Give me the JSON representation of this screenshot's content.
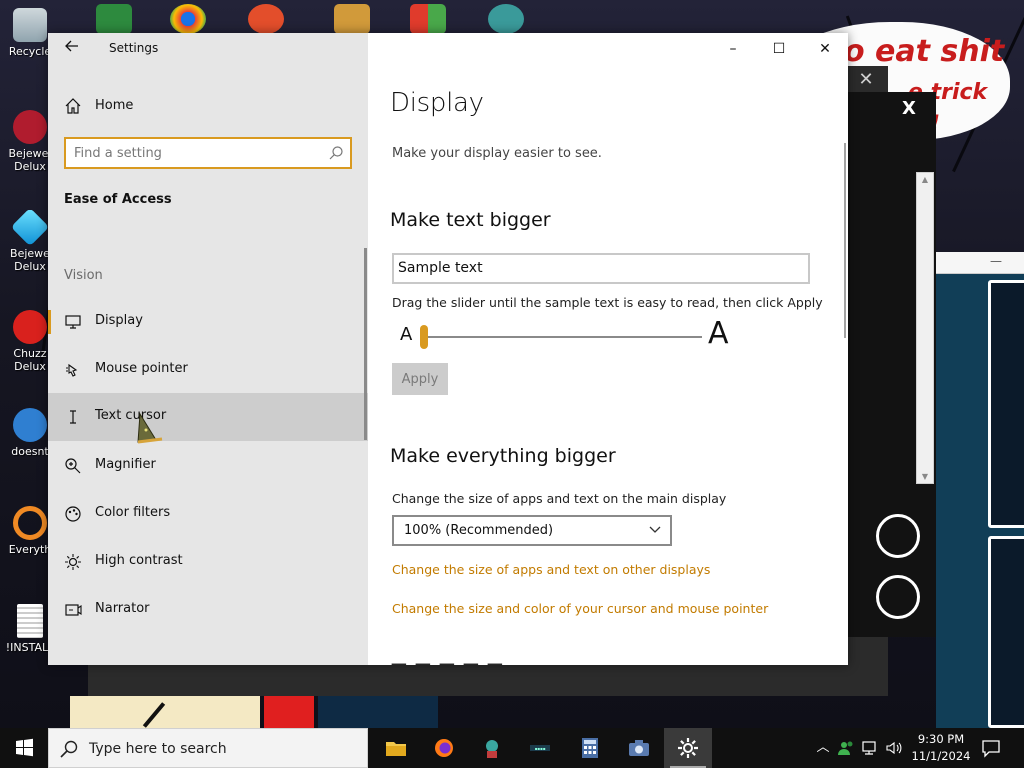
{
  "desktop": {
    "icons": [
      {
        "label": "Recycle",
        "name": "recycle-bin"
      },
      {
        "label": "Bejewel Delux",
        "name": "bejeweled-2"
      },
      {
        "label": "Bejewe Delux",
        "name": "bejeweled-3"
      },
      {
        "label": "Chuzz Delux",
        "name": "chuzzle"
      },
      {
        "label": "doesnt",
        "name": "doesnt"
      },
      {
        "label": "Everyth",
        "name": "everything"
      },
      {
        "label": "!INSTALL",
        "name": "install"
      }
    ],
    "meme_lines": [
      "o eat shit",
      "e trick",
      "!"
    ]
  },
  "settings": {
    "window_title": "Settings",
    "caption": {
      "minimize": "–",
      "maximize": "☐",
      "close": "✕"
    },
    "nav": {
      "home": "Home",
      "search_placeholder": "Find a setting",
      "section": "Ease of Access",
      "group": "Vision",
      "items": [
        {
          "label": "Display",
          "icon": "monitor-icon"
        },
        {
          "label": "Mouse pointer",
          "icon": "mouse-pointer-icon"
        },
        {
          "label": "Text cursor",
          "icon": "text-cursor-icon"
        },
        {
          "label": "Magnifier",
          "icon": "magnifier-icon"
        },
        {
          "label": "Color filters",
          "icon": "color-filters-icon"
        },
        {
          "label": "High contrast",
          "icon": "high-contrast-icon"
        },
        {
          "label": "Narrator",
          "icon": "narrator-icon"
        }
      ],
      "selected": "Display",
      "hovered": "Text cursor"
    },
    "content": {
      "title": "Display",
      "subtitle": "Make your display easier to see.",
      "text_section": {
        "heading": "Make text bigger",
        "sample": "Sample text",
        "instruction": "Drag the slider until the sample text is easy to read, then click Apply",
        "slider_min_label": "A",
        "slider_max_label": "A",
        "slider_value_percent": 100,
        "apply": "Apply"
      },
      "scale_section": {
        "heading": "Make everything bigger",
        "label": "Change the size of apps and text on the main display",
        "selected": "100% (Recommended)",
        "link_other_displays": "Change the size of apps and text on other displays",
        "link_cursor": "Change the size and color of your cursor and mouse pointer"
      }
    }
  },
  "taskbar": {
    "search_placeholder": "Type here to search",
    "apps": [
      "file-explorer",
      "firefox",
      "game-character",
      "chrome-app",
      "calculator",
      "camera",
      "settings"
    ],
    "active_app": "settings",
    "time": "9:30 PM",
    "date": "11/1/2024"
  },
  "colors": {
    "accent": "#d99a20",
    "link": "#c27b00",
    "nav_bg": "#e6e6e6",
    "taskbar_bg": "#101010"
  }
}
